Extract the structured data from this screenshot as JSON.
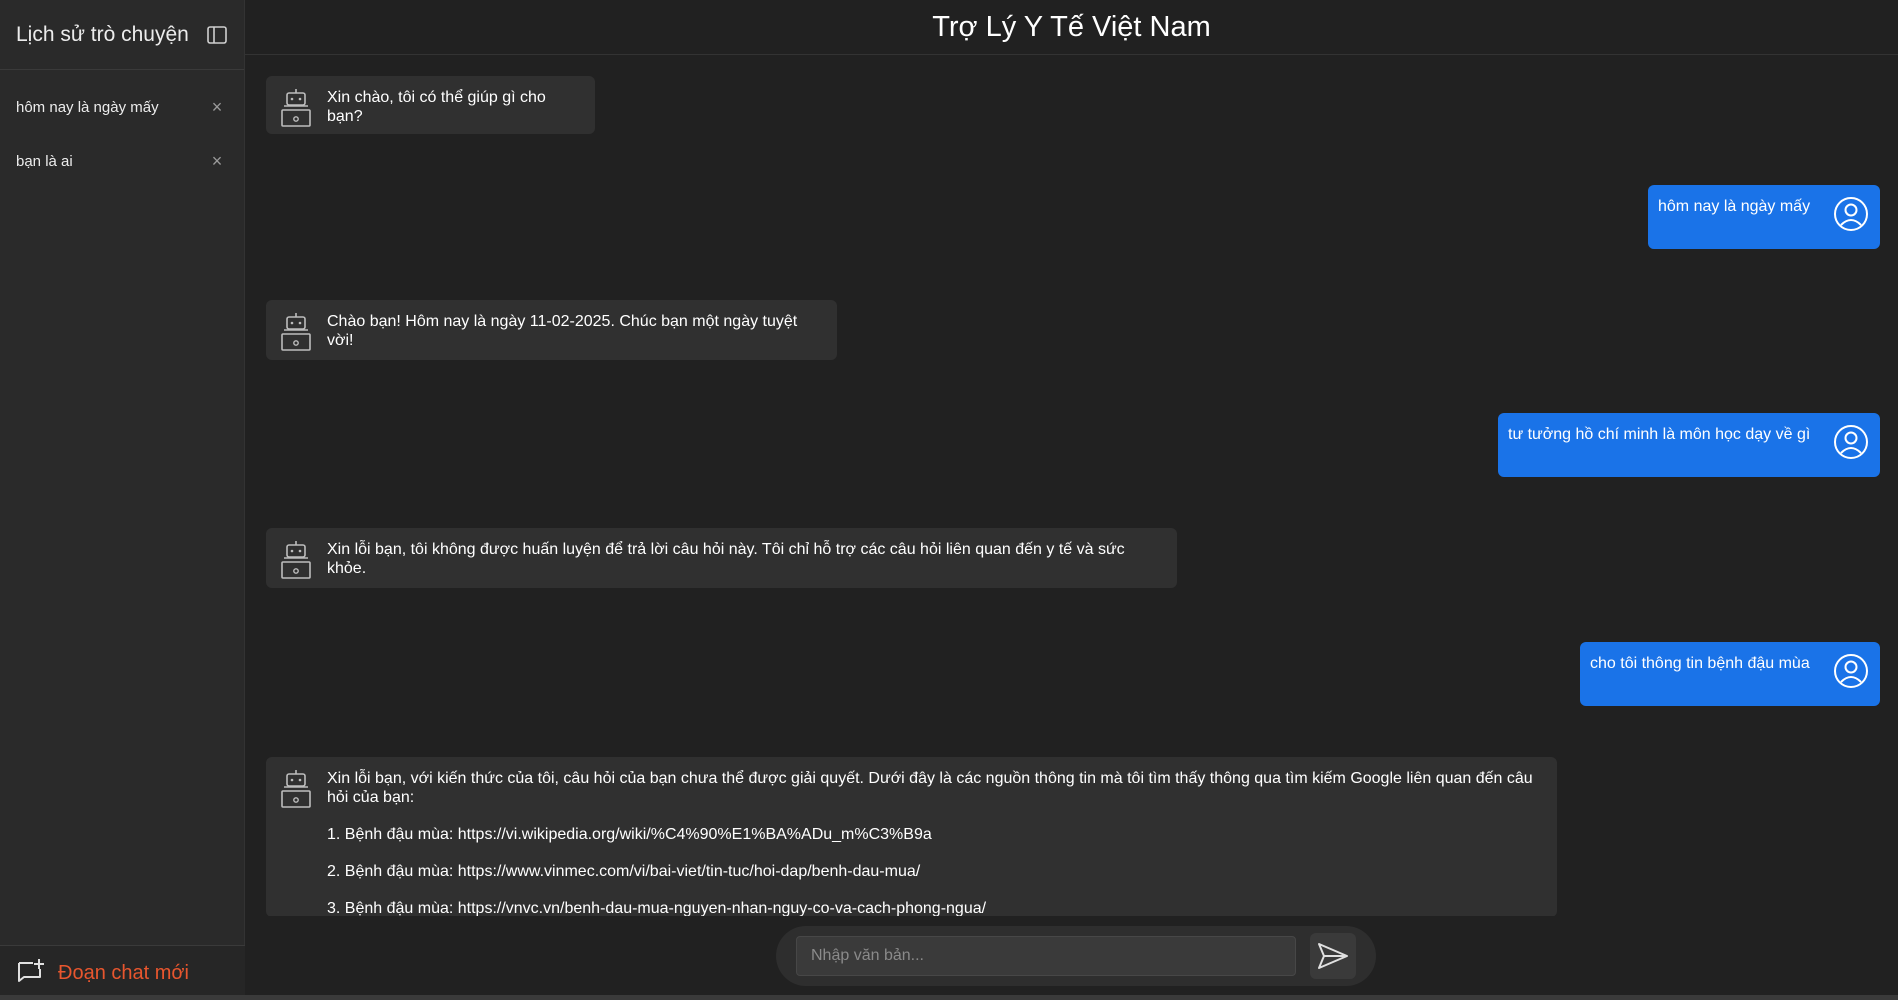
{
  "sidebar": {
    "title": "Lịch sử trò chuyện",
    "toggle_icon": "sidebar-toggle-icon",
    "items": [
      {
        "label": "hôm nay là ngày mấy"
      },
      {
        "label": "bạn là ai"
      }
    ],
    "close_glyph": "×",
    "new_chat_label": "Đoạn chat mới"
  },
  "header": {
    "title": "Trợ Lý Y Tế Việt Nam"
  },
  "messages": [
    {
      "role": "bot",
      "text": "Xin chào, tôi có thể giúp gì cho bạn?"
    },
    {
      "role": "user",
      "text": "hôm nay là ngày mấy"
    },
    {
      "role": "bot",
      "text": "Chào bạn! Hôm nay là ngày 11-02-2025. Chúc bạn một ngày tuyệt vời!"
    },
    {
      "role": "user",
      "text": "tư tưởng hồ chí minh là môn học dạy về gì"
    },
    {
      "role": "bot",
      "text": "Xin lỗi bạn, tôi không được huấn luyện để trả lời câu hỏi này. Tôi chỉ hỗ trợ các câu hỏi liên quan đến y tế và sức khỏe."
    },
    {
      "role": "user",
      "text": "cho tôi thông tin bệnh đậu mùa"
    },
    {
      "role": "bot",
      "text": "Xin lỗi bạn, với kiến thức của tôi, câu hỏi của bạn chưa thể được giải quyết. Dưới đây là các nguồn thông tin mà tôi tìm thấy thông qua tìm kiếm Google liên quan đến câu hỏi của bạn:",
      "links": [
        "1. Bệnh đậu mùa: https://vi.wikipedia.org/wiki/%C4%90%E1%BA%ADu_m%C3%B9a",
        "2. Bệnh đậu mùa: https://www.vinmec.com/vi/bai-viet/tin-tuc/hoi-dap/benh-dau-mua/",
        "3. Bệnh đậu mùa: https://vnvc.vn/benh-dau-mua-nguyen-nhan-nguy-co-va-cach-phong-ngua/"
      ]
    }
  ],
  "input": {
    "placeholder": "Nhập văn bản...",
    "value": ""
  },
  "colors": {
    "background": "#212121",
    "sidebar": "#2a2a2a",
    "bot_bubble": "#303030",
    "user_bubble": "#1a73e8",
    "new_chat_accent": "#e8562e"
  }
}
